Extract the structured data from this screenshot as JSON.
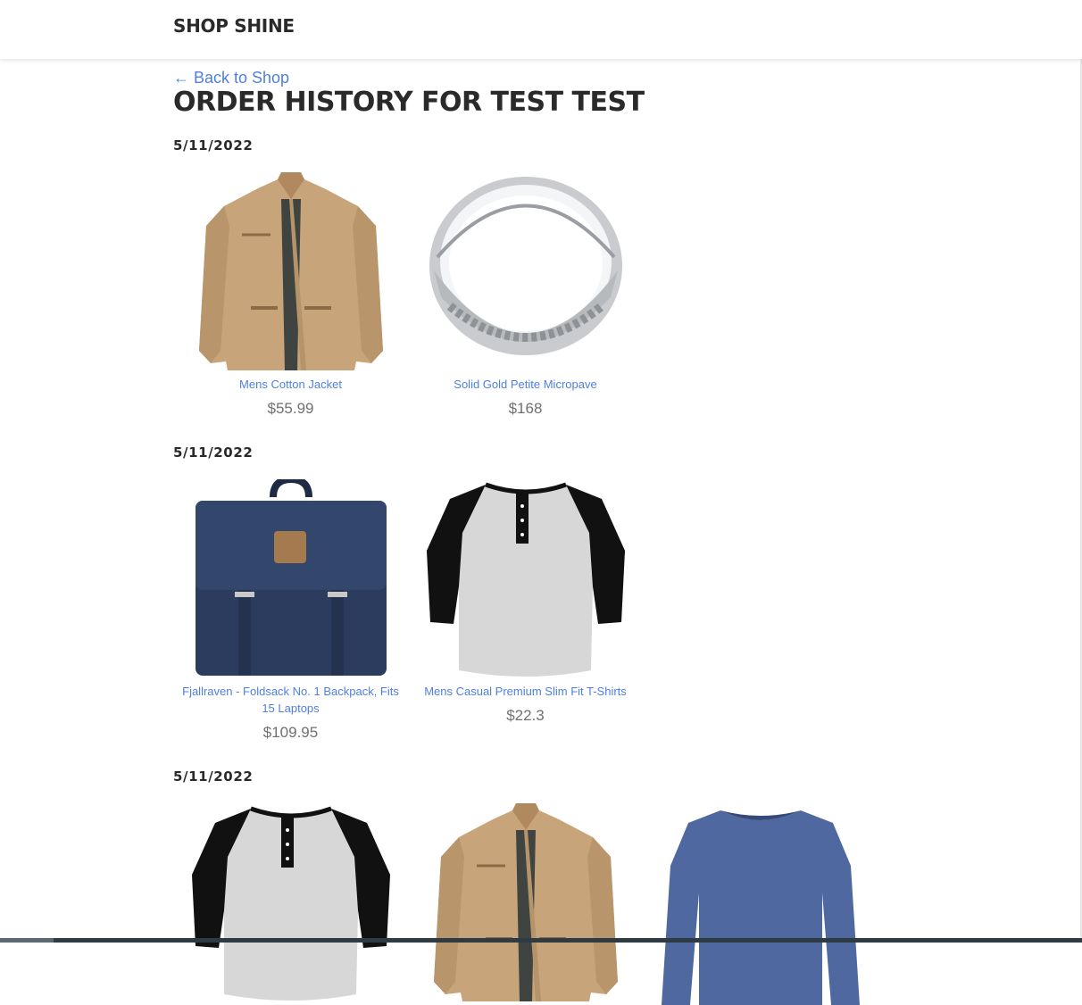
{
  "header": {
    "brand": "SHOP SHINE"
  },
  "page": {
    "back_link": "← Back to Shop",
    "title": "ORDER HISTORY FOR TEST TEST"
  },
  "orders": [
    {
      "date": "5/11/2022",
      "products": [
        {
          "name": "Mens Cotton Jacket",
          "price": "$55.99",
          "image": "tan-jacket-image"
        },
        {
          "name": "Solid Gold Petite Micropave",
          "price": "$168",
          "image": "silver-ring-image"
        }
      ]
    },
    {
      "date": "5/11/2022",
      "products": [
        {
          "name": "Fjallraven - Foldsack No. 1 Backpack, Fits 15 Laptops",
          "price": "$109.95",
          "image": "navy-backpack-image"
        },
        {
          "name": "Mens Casual Premium Slim Fit T-Shirts",
          "price": "$22.3",
          "image": "raglan-shirt-image"
        }
      ]
    },
    {
      "date": "5/11/2022",
      "products": [
        {
          "image": "raglan-shirt-image"
        },
        {
          "image": "tan-jacket-image"
        },
        {
          "image": "blue-longsleeve-image"
        }
      ]
    }
  ],
  "colors": {
    "link": "#4f7fe0",
    "price": "#707070",
    "heading": "#2a2a2a"
  }
}
